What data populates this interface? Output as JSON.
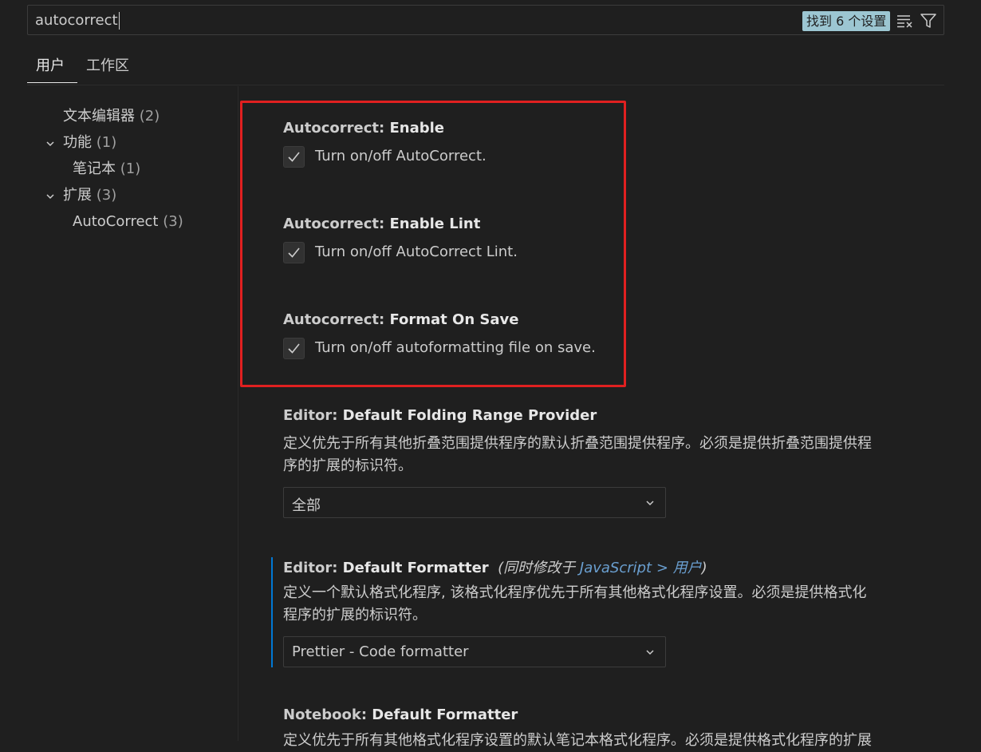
{
  "search": {
    "query": "autocorrect",
    "result_count": "找到 6 个设置",
    "clear_filter_icon": "clear-filter-icon",
    "filter_icon": "filter-icon"
  },
  "tabs": [
    {
      "label": "用户",
      "active": true
    },
    {
      "label": "工作区",
      "active": false
    }
  ],
  "toc": [
    {
      "label": "文本编辑器",
      "count": "(2)",
      "expandable": false
    },
    {
      "label": "功能",
      "count": "(1)",
      "expandable": true
    },
    {
      "label": "笔记本",
      "count": "(1)",
      "expandable": false
    },
    {
      "label": "扩展",
      "count": "(3)",
      "expandable": true
    },
    {
      "label": "AutoCorrect",
      "count": "(3)",
      "expandable": false
    }
  ],
  "settings": [
    {
      "category": "Autocorrect: ",
      "name": "Enable",
      "checked": true,
      "description": "Turn on/off AutoCorrect."
    },
    {
      "category": "Autocorrect: ",
      "name": "Enable Lint",
      "checked": true,
      "description": "Turn on/off AutoCorrect Lint."
    },
    {
      "category": "Autocorrect: ",
      "name": "Format On Save",
      "checked": true,
      "description": "Turn on/off autoformatting file on save."
    },
    {
      "category": "Editor: ",
      "name": "Default Folding Range Provider",
      "description_line1": "定义优先于所有其他折叠范围提供程序的默认折叠范围提供程序。必须是提供折叠范围提供程",
      "description_line2": "序的扩展的标识符。",
      "value": "全部"
    },
    {
      "category": "Editor: ",
      "name": "Default Formatter",
      "modified_prefix": "(同时修改于 ",
      "modified_link": "JavaScript > 用户",
      "modified_suffix": ")",
      "description_line1": "定义一个默认格式化程序, 该格式化程序优先于所有其他格式化程序设置。必须是提供格式化",
      "description_line2": "程序的扩展的标识符。",
      "value": "Prettier - Code formatter"
    },
    {
      "category": "Notebook: ",
      "name": "Default Formatter",
      "description_line1": "定义优先于所有其他格式化程序设置的默认笔记本格式化程序。必须是提供格式化程序的扩展"
    }
  ],
  "colors": {
    "background": "#1f1f1f",
    "highlight_border": "#e02020",
    "modified_indicator": "#0078d4",
    "badge": "#9cc6d2"
  }
}
